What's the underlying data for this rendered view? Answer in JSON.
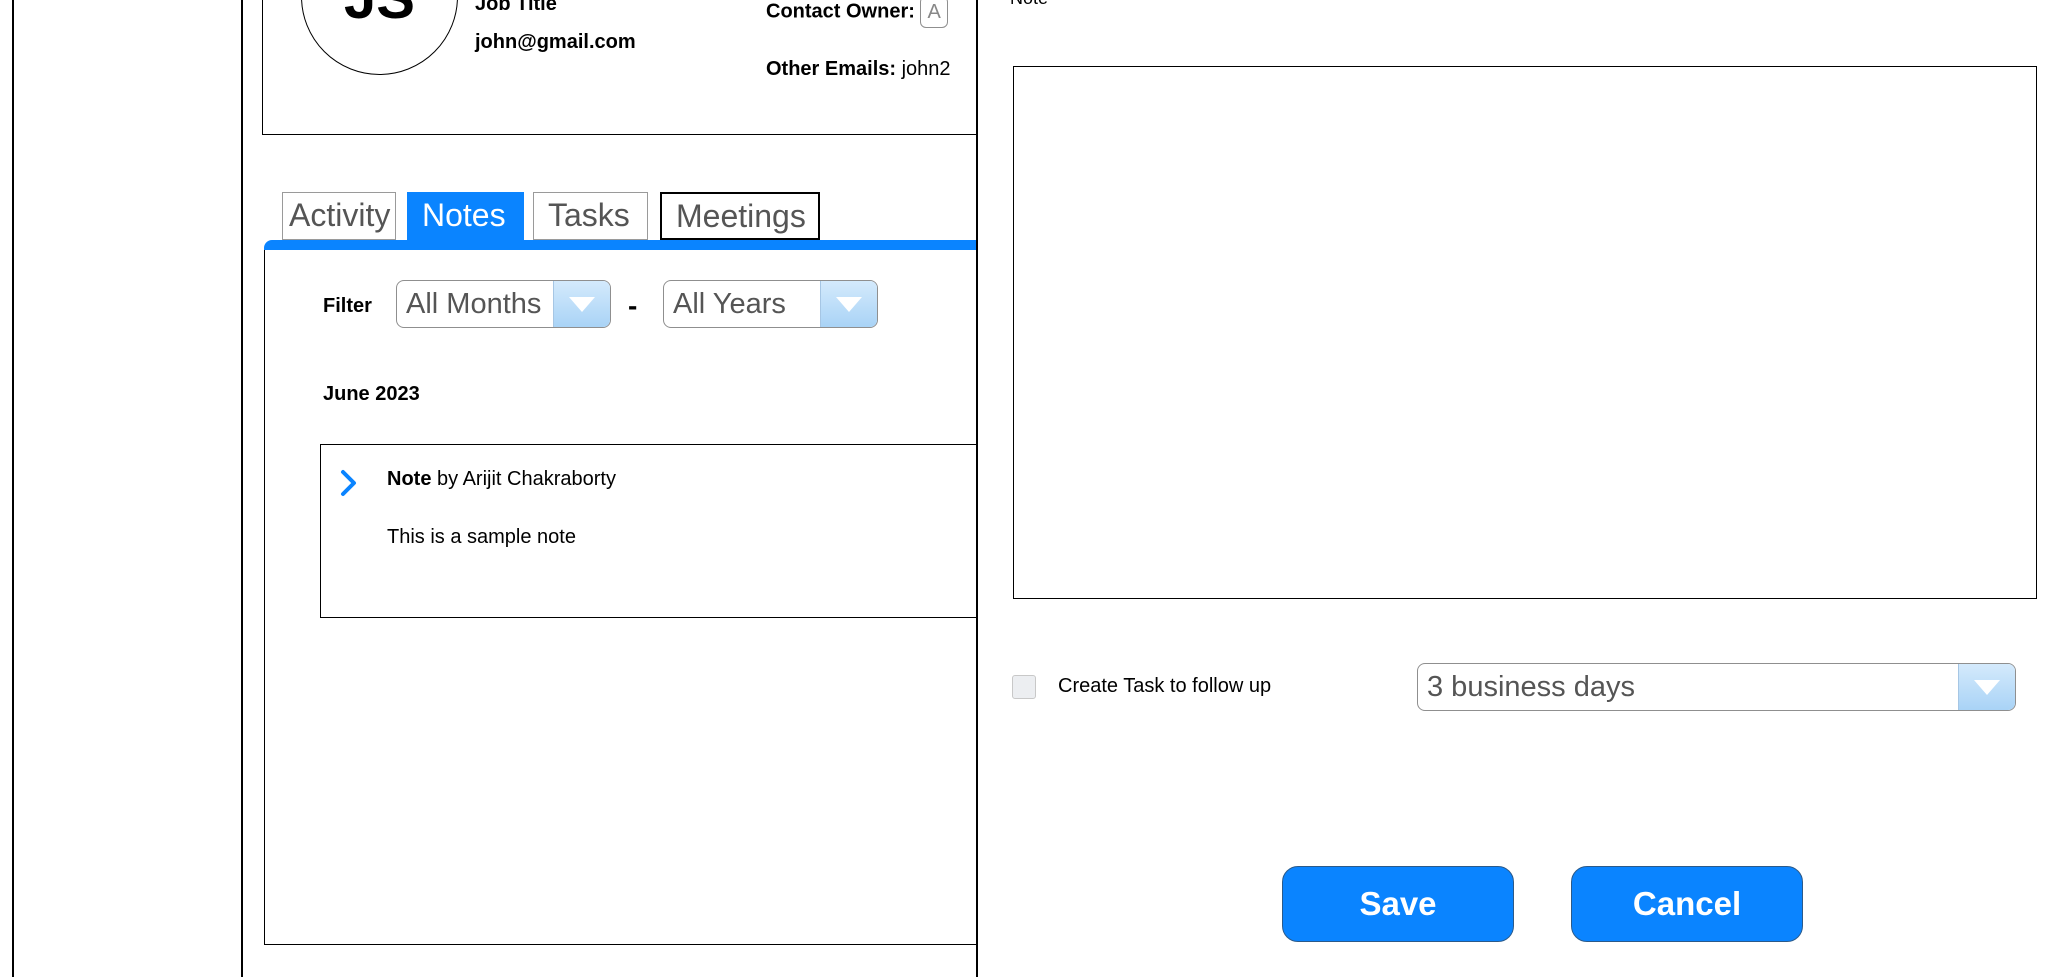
{
  "contact": {
    "initials": "JS",
    "job_title": "Job Title",
    "email": "john@gmail.com",
    "contact_owner_label": "Contact Owner:",
    "contact_owner_value": "A",
    "other_emails_label": "Other Emails:",
    "other_emails_value": "john2"
  },
  "tabs": [
    {
      "label": "Activity",
      "active": false
    },
    {
      "label": "Notes",
      "active": true
    },
    {
      "label": "Tasks",
      "active": false
    },
    {
      "label": "Meetings",
      "active": false
    }
  ],
  "filter": {
    "label": "Filter",
    "months_value": "All Months",
    "separator": "-",
    "years_value": "All Years"
  },
  "notes_section": {
    "period_heading": "June 2023",
    "note": {
      "type_label": "Note",
      "author_text": "by Arijit Chakraborty",
      "body": "This is a sample note"
    }
  },
  "note_panel": {
    "field_label": "Note",
    "note_text": "",
    "followup_checkbox_label": "Create Task to follow up",
    "followup_checked": false,
    "followup_delay_value": "3 business days",
    "save_label": "Save",
    "cancel_label": "Cancel"
  },
  "colors": {
    "accent": "#0a84ff",
    "select_button": "#bcdcf8",
    "border": "#000000"
  },
  "icons": [
    "chevron-right-icon",
    "dropdown-arrow-icon"
  ]
}
